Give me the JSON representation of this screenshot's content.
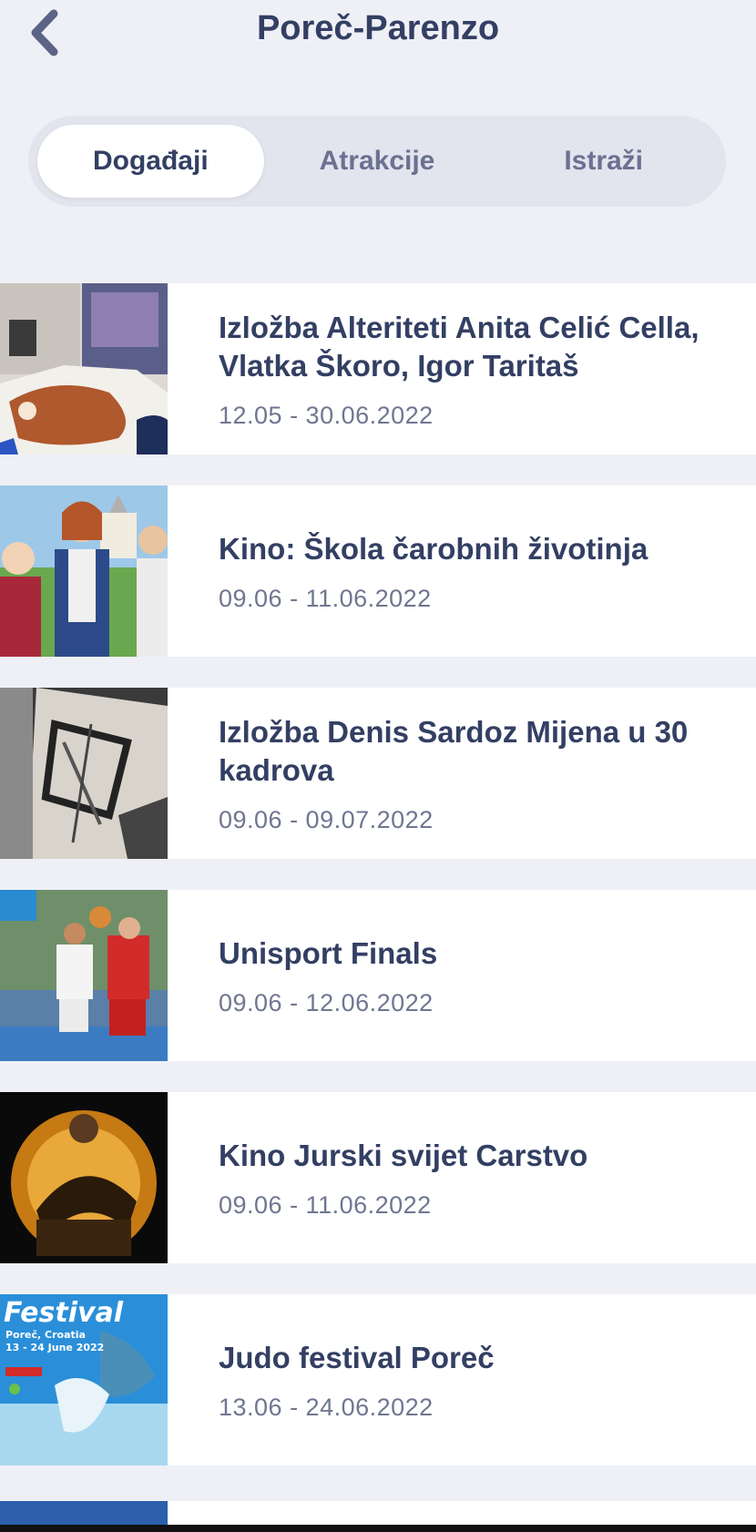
{
  "header": {
    "title": "Poreč-Parenzo",
    "back_icon": "chevron-left-icon"
  },
  "tabs": [
    {
      "label": "Događaji",
      "active": true
    },
    {
      "label": "Atrakcije",
      "active": false
    },
    {
      "label": "Istraži",
      "active": false
    }
  ],
  "events": [
    {
      "title": "Izložba Alteriteti Anita Celić Cella, Vlatka Škoro, Igor Taritaš",
      "date": "12.05 - 30.06.2022"
    },
    {
      "title": "Kino: Škola čarobnih životinja",
      "date": "09.06 - 11.06.2022"
    },
    {
      "title": "Izložba Denis Sardoz Mijena u 30 kadrova",
      "date": "09.06 - 09.07.2022"
    },
    {
      "title": "Unisport Finals",
      "date": "09.06 - 12.06.2022"
    },
    {
      "title": "Kino Jurski svijet Carstvo",
      "date": "09.06 - 11.06.2022"
    },
    {
      "title": "Judo festival Poreč",
      "date": "13.06 - 24.06.2022"
    }
  ],
  "thumbnails": {
    "judo_poster_lines": [
      "Festival",
      "Poreč, Croatia",
      "13 - 24 June 2022"
    ]
  },
  "colors": {
    "primary_text": "#333f63",
    "secondary_text": "#6f7690",
    "background": "#eff0f6"
  }
}
